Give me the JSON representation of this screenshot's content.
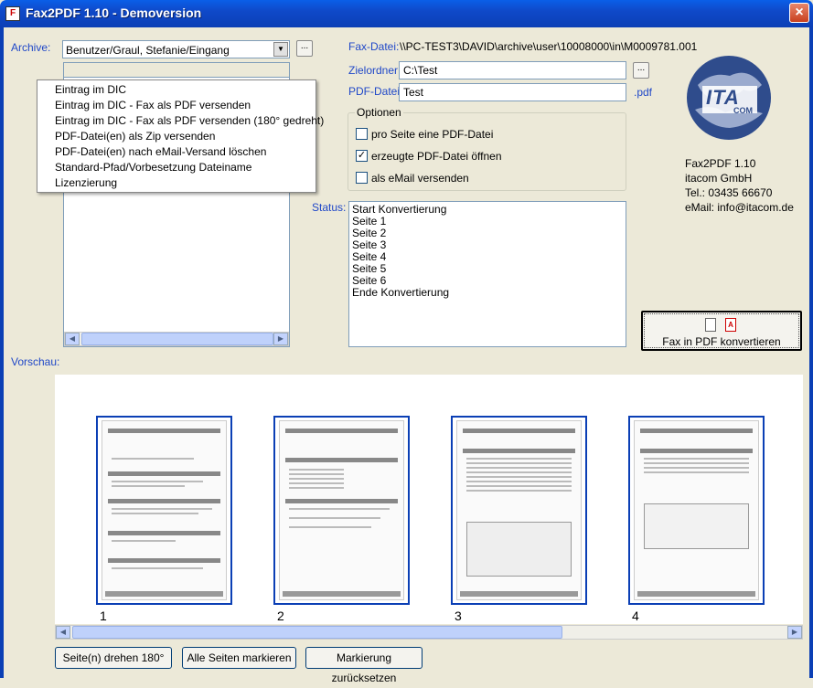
{
  "window": {
    "title": "Fax2PDF 1.10 - Demoversion",
    "close_glyph": "×"
  },
  "archive": {
    "label": "Archive:",
    "path": "Benutzer/Graul, Stefanie/Eingang",
    "browse": "..."
  },
  "menu": {
    "items": [
      "Eintrag im DIC",
      "Eintrag im DIC - Fax als PDF versenden",
      "Eintrag im DIC - Fax als PDF versenden (180° gedreht)",
      "PDF-Datei(en) als Zip versenden",
      "PDF-Datei(en) nach eMail-Versand löschen",
      "Standard-Pfad/Vorbesetzung Dateiname",
      "Lizenzierung"
    ]
  },
  "fax_file": {
    "label": "Fax-Datei:",
    "value": "\\\\PC-TEST3\\DAVID\\archive\\user\\10008000\\in\\M0009781.001"
  },
  "target": {
    "label": "Zielordner:",
    "value": "C:\\Test",
    "browse": "..."
  },
  "pdf_file": {
    "label": "PDF-Datei:",
    "value": "Test",
    "ext": ".pdf"
  },
  "options": {
    "legend": "Optionen",
    "items": [
      {
        "label": "pro Seite eine PDF-Datei",
        "checked": false
      },
      {
        "label": "erzeugte PDF-Datei öffnen",
        "checked": true
      },
      {
        "label": "als eMail versenden",
        "checked": false
      }
    ]
  },
  "status": {
    "label": "Status:",
    "lines": [
      "Start Konvertierung",
      "Seite 1",
      "Seite 2",
      "Seite 3",
      "Seite 4",
      "Seite 5",
      "Seite 6",
      "Ende Konvertierung"
    ]
  },
  "company": {
    "logo_text": "ITA",
    "logo_sub": "COM",
    "product": "Fax2PDF 1.10",
    "name": "itacom GmbH",
    "phone": "Tel.: 03435 66670",
    "email": "eMail: info@itacom.de"
  },
  "convert_button": {
    "label": "Fax in PDF konvertieren",
    "icons": [
      "document-icon",
      "pdf-icon"
    ]
  },
  "preview": {
    "label": "Vorschau:",
    "pages": [
      "1",
      "2",
      "3",
      "4"
    ]
  },
  "buttons": {
    "rotate": "Seite(n) drehen 180°",
    "mark_all": "Alle Seiten markieren",
    "reset": "Markierung zurücksetzen"
  },
  "colors": {
    "title_bar": "#0B3FB5",
    "label_blue": "#2048C8",
    "thumb_border": "#0B3FB5"
  }
}
